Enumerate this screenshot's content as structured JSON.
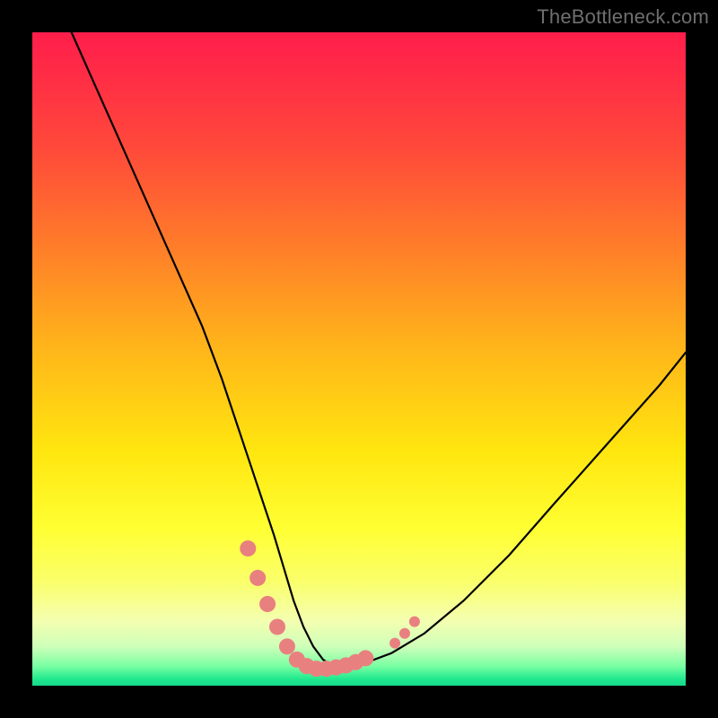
{
  "watermark": "TheBottleneck.com",
  "chart_data": {
    "type": "line",
    "title": "",
    "xlabel": "",
    "ylabel": "",
    "xlim": [
      0,
      100
    ],
    "ylim": [
      0,
      100
    ],
    "grid": false,
    "legend": false,
    "series": [
      {
        "name": "bottleneck-curve",
        "color": "#000000",
        "x": [
          6,
          10,
          14,
          18,
          22,
          26,
          29,
          31,
          33,
          35,
          37,
          38.5,
          40,
          41.5,
          43,
          44.5,
          46,
          48,
          51,
          55,
          60,
          66,
          73,
          80,
          88,
          96,
          100
        ],
        "y": [
          100,
          91,
          82,
          73,
          64,
          55,
          47,
          41,
          35,
          29,
          23,
          18,
          13,
          9,
          6,
          4,
          3,
          3,
          3.5,
          5,
          8,
          13,
          20,
          28,
          37,
          46,
          51
        ]
      }
    ],
    "markers": [
      {
        "name": "highlight-dots",
        "color": "#e98080",
        "radius_major": 9,
        "radius_minor": 6,
        "points": [
          {
            "x": 33.0,
            "y": 21.0,
            "r": "major"
          },
          {
            "x": 34.5,
            "y": 16.5,
            "r": "major"
          },
          {
            "x": 36.0,
            "y": 12.5,
            "r": "major"
          },
          {
            "x": 37.5,
            "y": 9.0,
            "r": "major"
          },
          {
            "x": 39.0,
            "y": 6.0,
            "r": "major"
          },
          {
            "x": 40.5,
            "y": 4.0,
            "r": "major"
          },
          {
            "x": 42.0,
            "y": 3.0,
            "r": "major"
          },
          {
            "x": 43.5,
            "y": 2.6,
            "r": "major"
          },
          {
            "x": 45.0,
            "y": 2.6,
            "r": "major"
          },
          {
            "x": 46.5,
            "y": 2.8,
            "r": "major"
          },
          {
            "x": 48.0,
            "y": 3.1,
            "r": "major"
          },
          {
            "x": 49.5,
            "y": 3.6,
            "r": "major"
          },
          {
            "x": 51.0,
            "y": 4.2,
            "r": "major"
          },
          {
            "x": 55.5,
            "y": 6.5,
            "r": "minor"
          },
          {
            "x": 57.0,
            "y": 8.0,
            "r": "minor"
          },
          {
            "x": 58.5,
            "y": 9.8,
            "r": "minor"
          }
        ]
      }
    ]
  }
}
